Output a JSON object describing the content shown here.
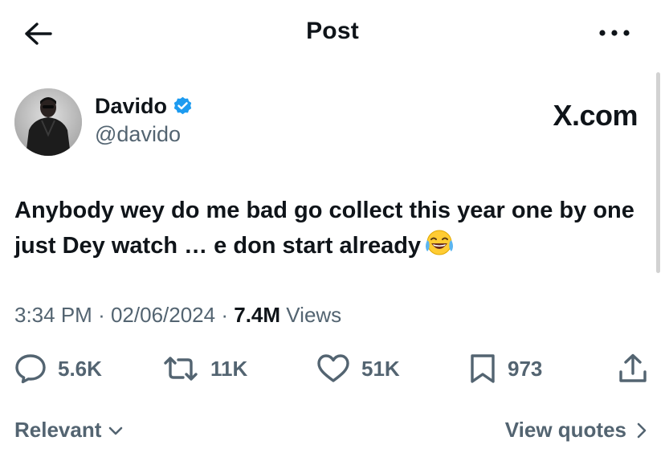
{
  "header": {
    "title": "Post",
    "back_icon": "arrow-left-icon",
    "more_icon": "more-horizontal-icon"
  },
  "author": {
    "name": "Davido",
    "handle": "@davido",
    "verified": true,
    "verified_color": "#1d9bf0"
  },
  "watermark": "X.com",
  "post": {
    "text": "Anybody wey do me bad go collect this year one by one just Dey watch … e don start already",
    "emoji": "face-with-tears-of-joy-icon"
  },
  "meta": {
    "time": "3:34 PM",
    "separator": "·",
    "date": "02/06/2024",
    "views_count": "7.4M",
    "views_label": "Views"
  },
  "actions": {
    "replies": "5.6K",
    "reposts": "11K",
    "likes": "51K",
    "bookmarks": "973"
  },
  "footer": {
    "sort_label": "Relevant",
    "quotes_label": "View quotes"
  },
  "colors": {
    "text": "#0f1419",
    "secondary": "#536471",
    "accent": "#1d9bf0"
  }
}
